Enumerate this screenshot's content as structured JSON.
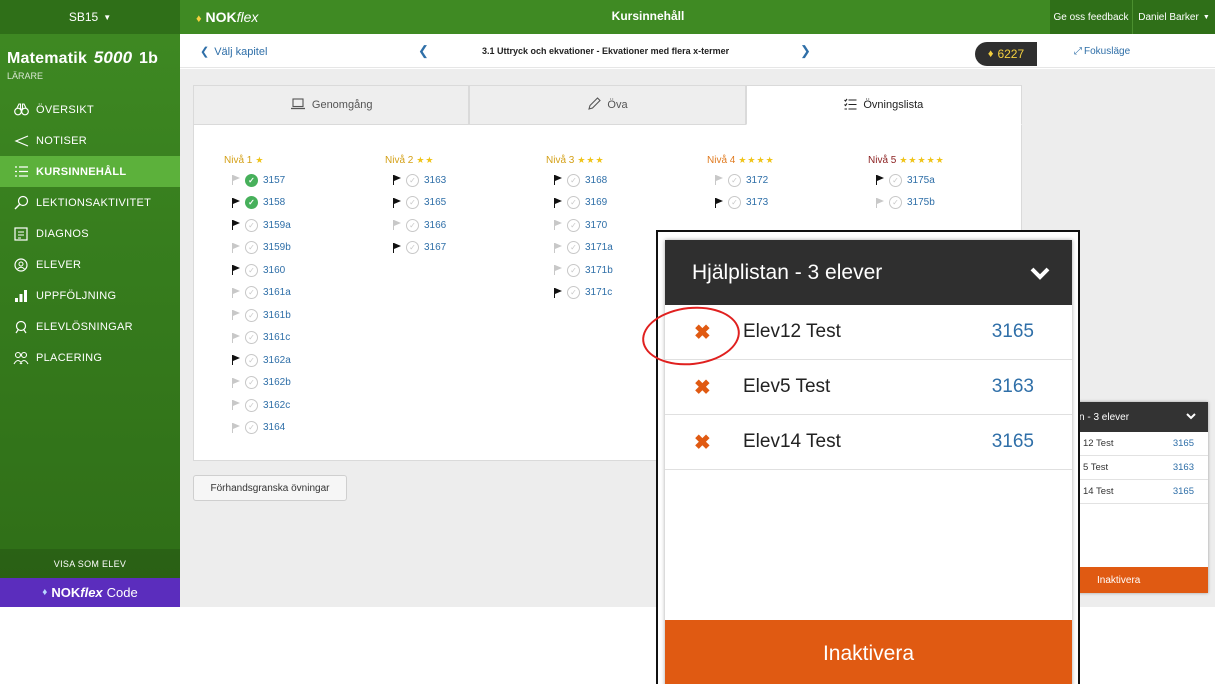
{
  "topbar": {
    "class_selector": "SB15",
    "logo_nok": "NOK",
    "logo_flex": "flex",
    "title": "Kursinnehåll",
    "feedback": "Ge oss feedback",
    "user": "Daniel Barker"
  },
  "sidebar": {
    "course_prefix": "Matematik",
    "course_number": "5000",
    "course_suffix": "1b",
    "role": "LÄRARE",
    "items": [
      {
        "label": "ÖVERSIKT",
        "icon": "binoculars-icon"
      },
      {
        "label": "NOTISER",
        "icon": "megaphone-icon"
      },
      {
        "label": "KURSINNEHÅLL",
        "icon": "list-icon"
      },
      {
        "label": "LEKTIONSAKTIVITET",
        "icon": "magnifier-person-icon"
      },
      {
        "label": "DIAGNOS",
        "icon": "diagnosis-icon"
      },
      {
        "label": "ELEVER",
        "icon": "student-icon"
      },
      {
        "label": "UPPFÖLJNING",
        "icon": "bar-chart-icon"
      },
      {
        "label": "ELEVLÖSNINGAR",
        "icon": "solutions-icon"
      },
      {
        "label": "PLACERING",
        "icon": "placement-icon"
      }
    ],
    "active_index": 2,
    "view_as_student": "VISA SOM ELEV",
    "code_nok": "NOK",
    "code_flex": "flex",
    "code_label": "Code"
  },
  "subheader": {
    "choose_chapter": "Välj kapitel",
    "chapter_title": "3.1 Uttryck och ekvationer - Ekvationer med flera x-termer",
    "focus_mode": "Fokusläge",
    "points": "6227"
  },
  "tabs": [
    {
      "label": "Genomgång",
      "icon": "laptop-icon"
    },
    {
      "label": "Öva",
      "icon": "pencil-icon"
    },
    {
      "label": "Övningslista",
      "icon": "checklist-icon"
    }
  ],
  "levels": [
    {
      "title": "Nivå 1",
      "stars": "★",
      "exercises": [
        {
          "num": "3157",
          "flag": "off",
          "done": true
        },
        {
          "num": "3158",
          "flag": "on",
          "done": true
        },
        {
          "num": "3159a",
          "flag": "on",
          "done": false
        },
        {
          "num": "3159b",
          "flag": "off",
          "done": false
        },
        {
          "num": "3160",
          "flag": "on",
          "done": false
        },
        {
          "num": "3161a",
          "flag": "off",
          "done": false
        },
        {
          "num": "3161b",
          "flag": "off",
          "done": false
        },
        {
          "num": "3161c",
          "flag": "off",
          "done": false
        },
        {
          "num": "3162a",
          "flag": "on",
          "done": false
        },
        {
          "num": "3162b",
          "flag": "off",
          "done": false
        },
        {
          "num": "3162c",
          "flag": "off",
          "done": false
        },
        {
          "num": "3164",
          "flag": "off",
          "done": false
        }
      ]
    },
    {
      "title": "Nivå 2",
      "stars": "★★",
      "exercises": [
        {
          "num": "3163",
          "flag": "on",
          "done": false
        },
        {
          "num": "3165",
          "flag": "on",
          "done": false
        },
        {
          "num": "3166",
          "flag": "off",
          "done": false
        },
        {
          "num": "3167",
          "flag": "on",
          "done": false
        }
      ]
    },
    {
      "title": "Nivå 3",
      "stars": "★★★",
      "exercises": [
        {
          "num": "3168",
          "flag": "on",
          "done": false
        },
        {
          "num": "3169",
          "flag": "on",
          "done": false
        },
        {
          "num": "3170",
          "flag": "off",
          "done": false
        },
        {
          "num": "3171a",
          "flag": "off",
          "done": false
        },
        {
          "num": "3171b",
          "flag": "off",
          "done": false
        },
        {
          "num": "3171c",
          "flag": "on",
          "done": false
        }
      ]
    },
    {
      "title": "Nivå 4",
      "stars": "★★★★",
      "exercises": [
        {
          "num": "3172",
          "flag": "off",
          "done": false
        },
        {
          "num": "3173",
          "flag": "on",
          "done": false
        }
      ]
    },
    {
      "title": "Nivå 5",
      "stars": "★★★★★",
      "exercises": [
        {
          "num": "3175a",
          "flag": "on",
          "done": false
        },
        {
          "num": "3175b",
          "flag": "off",
          "done": false
        }
      ]
    }
  ],
  "preview_button": "Förhandsgranska övningar",
  "help_list": {
    "title": "Hjälplistan - 3 elever",
    "small_title": "n - 3 elever",
    "entries": [
      {
        "name": "Elev12 Test",
        "small_name": "12 Test",
        "exercise": "3165"
      },
      {
        "name": "Elev5 Test",
        "small_name": "5 Test",
        "exercise": "3163"
      },
      {
        "name": "Elev14 Test",
        "small_name": "14 Test",
        "exercise": "3165"
      }
    ],
    "deactivate": "Inaktivera"
  },
  "colors": {
    "brand_green": "#3f8a23",
    "active_nav": "#5cb13b",
    "accent_orange": "#e05a12",
    "link_blue": "#2f6fa8",
    "code_purple": "#5b2dbd"
  }
}
